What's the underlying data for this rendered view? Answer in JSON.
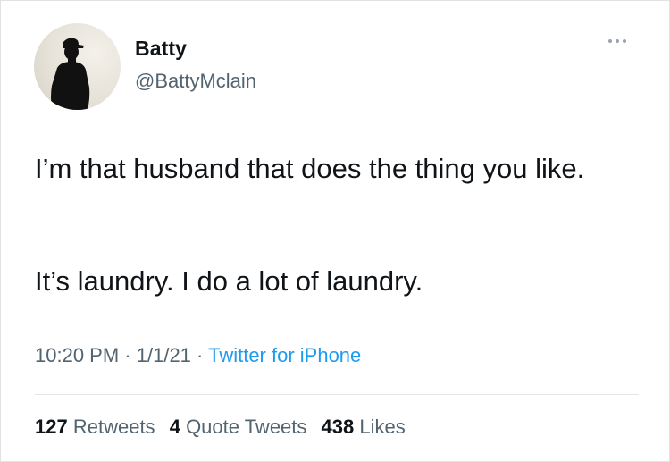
{
  "author": {
    "display_name": "Batty",
    "handle": "@BattyMclain",
    "avatar_icon": "silhouette-avatar"
  },
  "tweet": {
    "paragraphs": [
      "I’m that husband that does the thing you like.",
      "It’s laundry. I do a lot of laundry."
    ],
    "time": "10:20 PM",
    "separator": "·",
    "date": "1/1/21",
    "source": "Twitter for iPhone"
  },
  "stats": {
    "retweets_count": "127",
    "retweets_label": "Retweets",
    "quote_count": "4",
    "quote_label": "Quote Tweets",
    "likes_count": "438",
    "likes_label": "Likes"
  },
  "icons": {
    "more": "more-options-icon"
  },
  "colors": {
    "text_primary": "#0f1419",
    "text_secondary": "#536471",
    "link": "#1d9bf0",
    "divider": "#e3e6e8"
  }
}
